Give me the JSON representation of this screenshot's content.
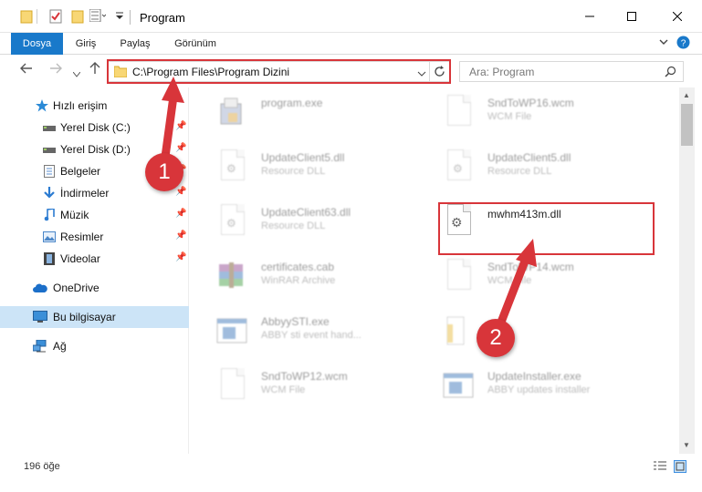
{
  "window": {
    "title": "Program",
    "controls": [
      "minimize",
      "maximize",
      "close"
    ]
  },
  "ribbon": {
    "tabs": [
      "Dosya",
      "Giriş",
      "Paylaş",
      "Görünüm"
    ]
  },
  "navigation": {
    "address": "C:\\Program Files\\Program Dizini",
    "search_placeholder": "Ara: Program"
  },
  "sidebar": {
    "items": [
      {
        "label": "Hızlı erişim",
        "icon": "star-icon",
        "pinned": false,
        "selected": false
      },
      {
        "label": "Yerel Disk (C:)",
        "icon": "drive-icon",
        "pinned": true,
        "selected": false
      },
      {
        "label": "Yerel Disk (D:)",
        "icon": "drive-icon",
        "pinned": true,
        "selected": false
      },
      {
        "label": "Belgeler",
        "icon": "documents-icon",
        "pinned": true,
        "selected": false
      },
      {
        "label": "İndirmeler",
        "icon": "download-icon",
        "pinned": true,
        "selected": false
      },
      {
        "label": "Müzik",
        "icon": "music-icon",
        "pinned": true,
        "selected": false
      },
      {
        "label": "Resimler",
        "icon": "pictures-icon",
        "pinned": true,
        "selected": false
      },
      {
        "label": "Videolar",
        "icon": "videos-icon",
        "pinned": true,
        "selected": false
      },
      {
        "label": "OneDrive",
        "icon": "cloud-icon",
        "pinned": false,
        "selected": false
      },
      {
        "label": "Bu bilgisayar",
        "icon": "computer-icon",
        "pinned": false,
        "selected": true
      },
      {
        "label": "Ağ",
        "icon": "network-icon",
        "pinned": false,
        "selected": false
      }
    ]
  },
  "files": [
    {
      "name": "program.exe",
      "type": "",
      "icon": "program-exe-icon"
    },
    {
      "name": "SndToWP16.wcm",
      "type": "WCM File",
      "icon": "blank-file-icon"
    },
    {
      "name": "UpdateClient5.dll",
      "type": "Resource DLL",
      "icon": "dll-file-icon"
    },
    {
      "name": "UpdateClient5.dll",
      "type": "Resource DLL",
      "icon": "dll-file-icon"
    },
    {
      "name": "UpdateClient63.dll",
      "type": "Resource DLL",
      "icon": "dll-file-icon"
    },
    {
      "name": "mwhm413m.dll",
      "type": "",
      "icon": "dll-file-icon"
    },
    {
      "name": "certificates.cab",
      "type": "WinRAR Archive",
      "icon": "winrar-archive-icon"
    },
    {
      "name": "SndToWP14.wcm",
      "type": "WCM File",
      "icon": "blank-file-icon"
    },
    {
      "name": "AbbyySTI.exe",
      "type": "ABBY sti event hand...",
      "icon": "application-window-icon"
    },
    {
      "name": "",
      "type": "",
      "icon": "folder-file-icon"
    },
    {
      "name": "SndToWP12.wcm",
      "type": "WCM File",
      "icon": "blank-file-icon"
    },
    {
      "name": "UpdateInstaller.exe",
      "type": "ABBY updates installer",
      "icon": "application-window-icon"
    }
  ],
  "status": {
    "item_count": "196 öğe"
  },
  "annotations": {
    "step1": "1",
    "step2": "2"
  },
  "colors": {
    "accent": "#1979ca",
    "annotation_red": "#d8353a",
    "selection": "#cce4f7"
  }
}
